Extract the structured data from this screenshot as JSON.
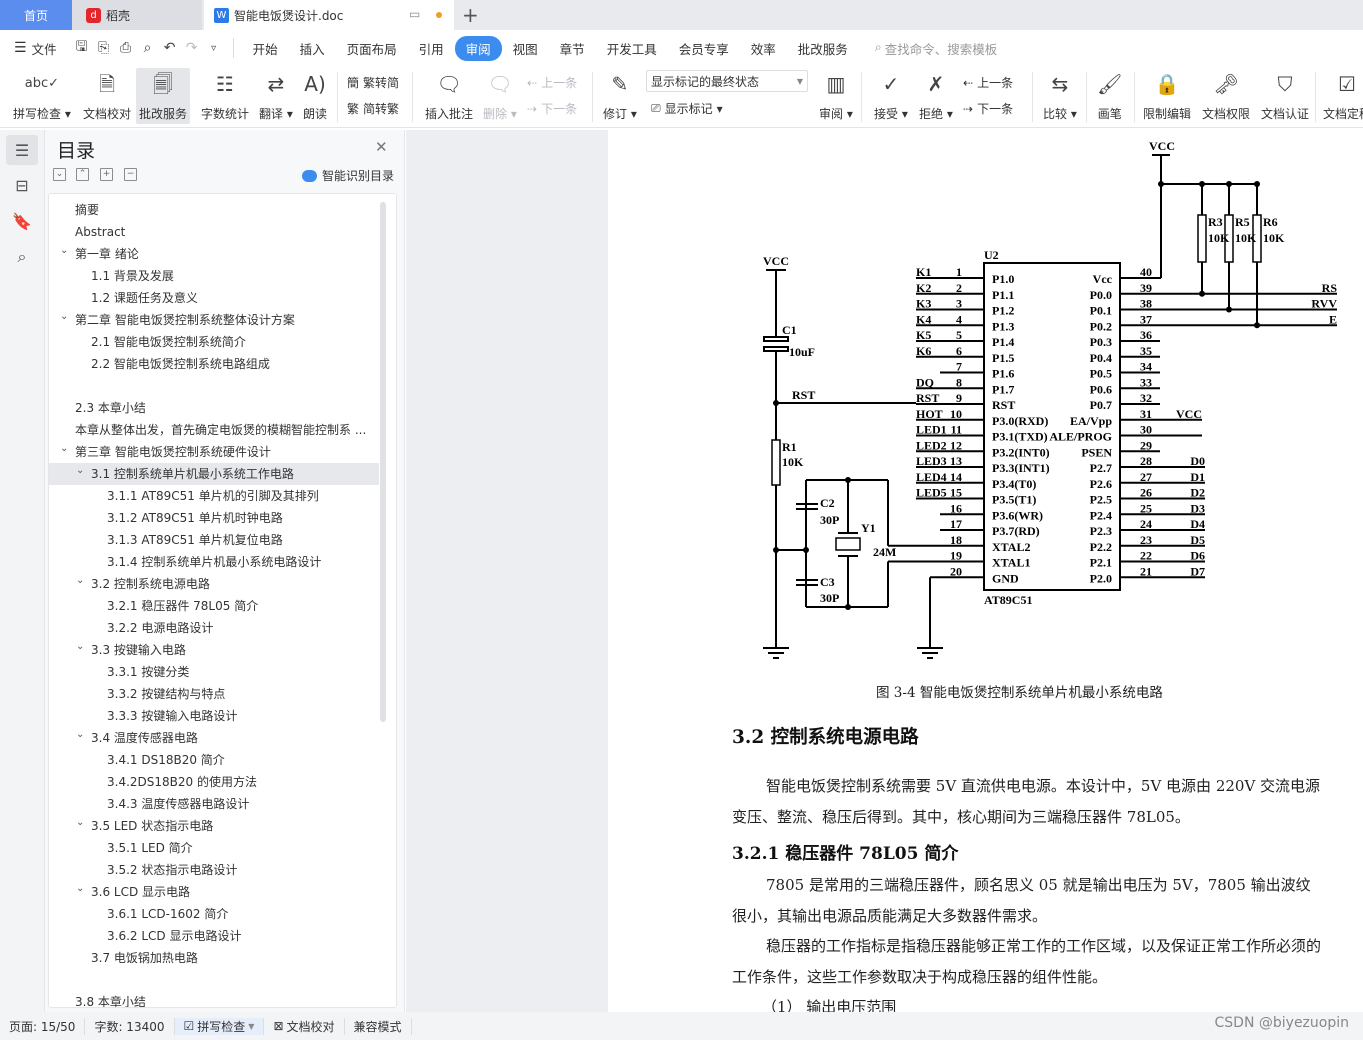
{
  "tabs": {
    "home": "首页",
    "daoke": "稻壳",
    "doc": "智能电饭煲设计.doc"
  },
  "menu": {
    "file": "文件",
    "items": [
      "开始",
      "插入",
      "页面布局",
      "引用",
      "审阅",
      "视图",
      "章节",
      "开发工具",
      "会员专享",
      "效率",
      "批改服务"
    ],
    "active": "审阅",
    "search_placeholder": "查找命令、搜索模板"
  },
  "ribbon": {
    "spell": "拼写检查",
    "proof": "文档校对",
    "grading": "批改服务",
    "wordcount": "字数统计",
    "translate": "翻译",
    "read": "朗读",
    "t2s": "繁转简",
    "s2t": "简转繁",
    "insert_comment": "插入批注",
    "delete": "删除",
    "prev_comment": "上一条",
    "next_comment": "下一条",
    "revise": "修订",
    "markup_state": "显示标记的最终状态",
    "show_markup": "显示标记",
    "review": "审阅",
    "accept": "接受",
    "reject": "拒绝",
    "prev_change": "上一条",
    "next_change": "下一条",
    "compare": "比较",
    "pen": "画笔",
    "restrict": "限制编辑",
    "permission": "文档权限",
    "certify": "文档认证",
    "finalize": "文档定稿"
  },
  "toc": {
    "title": "目录",
    "smart": "智能识别目录",
    "items": [
      {
        "label": "摘要",
        "level": 0
      },
      {
        "label": "Abstract",
        "level": 0
      },
      {
        "label": "第一章  绪论",
        "level": 0,
        "expanded": true
      },
      {
        "label": "1.1  背景及发展",
        "level": 1
      },
      {
        "label": "1.2  课题任务及意义",
        "level": 1
      },
      {
        "label": "第二章  智能电饭煲控制系统整体设计方案",
        "level": 0,
        "expanded": true
      },
      {
        "label": "2.1  智能电饭煲控制系统简介",
        "level": 1
      },
      {
        "label": "2.2  智能电饭煲控制系统电路组成",
        "level": 1
      },
      {
        "label": "",
        "level": 0
      },
      {
        "label": "2.3  本章小结",
        "level": 0
      },
      {
        "label": "本章从整体出发，首先确定电饭煲的模糊智能控制系 ...",
        "level": 0
      },
      {
        "label": "第三章  智能电饭煲控制系统硬件设计",
        "level": 0,
        "expanded": true
      },
      {
        "label": "3.1  控制系统单片机最小系统工作电路",
        "level": 1,
        "expanded": true,
        "selected": true
      },
      {
        "label": "3.1.1 AT89C51 单片机的引脚及其排列",
        "level": 2
      },
      {
        "label": "3.1.2 AT89C51 单片机时钟电路",
        "level": 2
      },
      {
        "label": "3.1.3 AT89C51 单片机复位电路",
        "level": 2
      },
      {
        "label": "3.1.4 控制系统单片机最小系统电路设计",
        "level": 2
      },
      {
        "label": "3.2  控制系统电源电路",
        "level": 1,
        "expanded": true
      },
      {
        "label": "3.2.1 稳压器件 78L05 简介",
        "level": 2
      },
      {
        "label": "3.2.2 电源电路设计",
        "level": 2
      },
      {
        "label": "3.3  按键输入电路",
        "level": 1,
        "expanded": true
      },
      {
        "label": "3.3.1 按键分类",
        "level": 2
      },
      {
        "label": "3.3.2 按键结构与特点",
        "level": 2
      },
      {
        "label": "3.3.3  按键输入电路设计",
        "level": 2
      },
      {
        "label": "3.4  温度传感器电路",
        "level": 1,
        "expanded": true
      },
      {
        "label": "3.4.1 DS18B20 简介",
        "level": 2
      },
      {
        "label": "3.4.2DS18B20 的使用方法",
        "level": 2
      },
      {
        "label": "3.4.3 温度传感器电路设计",
        "level": 2
      },
      {
        "label": "3.5 LED 状态指示电路",
        "level": 1,
        "expanded": true
      },
      {
        "label": "3.5.1 LED 简介",
        "level": 2
      },
      {
        "label": "3.5.2  状态指示电路设计",
        "level": 2
      },
      {
        "label": "3.6 LCD 显示电路",
        "level": 1,
        "expanded": true
      },
      {
        "label": "3.6.1 LCD-1602 简介",
        "level": 2
      },
      {
        "label": "3.6.2 LCD 显示电路设计",
        "level": 2
      },
      {
        "label": "3.7 电饭锅加热电路",
        "level": 1
      },
      {
        "label": "",
        "level": 0
      },
      {
        "label": "3.8  本章小结",
        "level": 0
      }
    ]
  },
  "schematic": {
    "chip": {
      "ref": "U2",
      "part": "AT89C51"
    },
    "left_pins": [
      {
        "n": "1",
        "net": "K1",
        "name": "P1.0"
      },
      {
        "n": "2",
        "net": "K2",
        "name": "P1.1"
      },
      {
        "n": "3",
        "net": "K3",
        "name": "P1.2"
      },
      {
        "n": "4",
        "net": "K4",
        "name": "P1.3"
      },
      {
        "n": "5",
        "net": "K5",
        "name": "P1.4"
      },
      {
        "n": "6",
        "net": "K6",
        "name": "P1.5"
      },
      {
        "n": "7",
        "net": "",
        "name": "P1.6"
      },
      {
        "n": "8",
        "net": "DQ",
        "name": "P1.7"
      },
      {
        "n": "9",
        "net": "RST",
        "name": "RST"
      },
      {
        "n": "10",
        "net": "HOT",
        "name": "P3.0(RXD)"
      },
      {
        "n": "11",
        "net": "LED1",
        "name": "P3.1(TXD)"
      },
      {
        "n": "12",
        "net": "LED2",
        "name": "P3.2(INT0)"
      },
      {
        "n": "13",
        "net": "LED3",
        "name": "P3.3(INT1)"
      },
      {
        "n": "14",
        "net": "LED4",
        "name": "P3.4(T0)"
      },
      {
        "n": "15",
        "net": "LED5",
        "name": "P3.5(T1)"
      },
      {
        "n": "16",
        "net": "",
        "name": "P3.6(WR)"
      },
      {
        "n": "17",
        "net": "",
        "name": "P3.7(RD)"
      },
      {
        "n": "18",
        "net": "",
        "name": "XTAL2"
      },
      {
        "n": "19",
        "net": "",
        "name": "XTAL1"
      },
      {
        "n": "20",
        "net": "",
        "name": "GND"
      }
    ],
    "right_pins": [
      {
        "n": "40",
        "net": "",
        "name": "Vcc"
      },
      {
        "n": "39",
        "net": "RS",
        "name": "P0.0"
      },
      {
        "n": "38",
        "net": "RVV",
        "name": "P0.1"
      },
      {
        "n": "37",
        "net": "E",
        "name": "P0.2"
      },
      {
        "n": "36",
        "net": "",
        "name": "P0.3"
      },
      {
        "n": "35",
        "net": "",
        "name": "P0.4"
      },
      {
        "n": "34",
        "net": "",
        "name": "P0.5"
      },
      {
        "n": "33",
        "net": "",
        "name": "P0.6"
      },
      {
        "n": "32",
        "net": "",
        "name": "P0.7"
      },
      {
        "n": "31",
        "net": "VCC",
        "name": "EA/Vpp"
      },
      {
        "n": "30",
        "net": "",
        "name": "ALE/PROG"
      },
      {
        "n": "29",
        "net": "",
        "name": "PSEN"
      },
      {
        "n": "28",
        "net": "D0",
        "name": "P2.7"
      },
      {
        "n": "27",
        "net": "D1",
        "name": "P2.6"
      },
      {
        "n": "26",
        "net": "D2",
        "name": "P2.5"
      },
      {
        "n": "25",
        "net": "D3",
        "name": "P2.4"
      },
      {
        "n": "24",
        "net": "D4",
        "name": "P2.3"
      },
      {
        "n": "23",
        "net": "D5",
        "name": "P2.2"
      },
      {
        "n": "22",
        "net": "D6",
        "name": "P2.1"
      },
      {
        "n": "21",
        "net": "D7",
        "name": "P2.0"
      }
    ],
    "vcc": "VCC",
    "rst": "RST",
    "c1": {
      "ref": "C1",
      "value": "10uF"
    },
    "r1": {
      "ref": "R1",
      "value": "10K"
    },
    "c2": {
      "ref": "C2",
      "value": "30P"
    },
    "c3": {
      "ref": "C3",
      "value": "30P"
    },
    "y1": {
      "ref": "Y1",
      "value": "24M"
    },
    "r3": {
      "ref": "R3",
      "value": "10K"
    },
    "r5": {
      "ref": "R5",
      "value": "10K"
    },
    "r6": {
      "ref": "R6",
      "value": "10K"
    }
  },
  "document": {
    "caption": "图 3-4  智能电饭煲控制系统单片机最小系统电路",
    "h32": "3.2  控制系统电源电路",
    "p1": "智能电饭煲控制系统需要 5V 直流供电电源。本设计中，5V 电源由 220V 交流电源变压、整流、稳压后得到。其中，核心期间为三端稳压器件 78L05。",
    "h321": "3.2.1 稳压器件 78L05 简介",
    "p2": "7805 是常用的三端稳压器件，顾名思义 05 就是输出电压为 5V，7805 输出波纹很小，其输出电源品质能满足大多数器件需求。",
    "p3": "稳压器的工作指标是指稳压器能够正常工作的工作区域，以及保证正常工作所必须的工作条件，这些工作参数取决于构成稳压器的组件性能。",
    "p4": "（1）  输出电压范围"
  },
  "status": {
    "page": "页面: 15/50",
    "words": "字数: 13400",
    "spell": "拼写检查",
    "proof": "文档校对",
    "compat": "兼容模式"
  },
  "watermark": "CSDN @biyezuopin"
}
